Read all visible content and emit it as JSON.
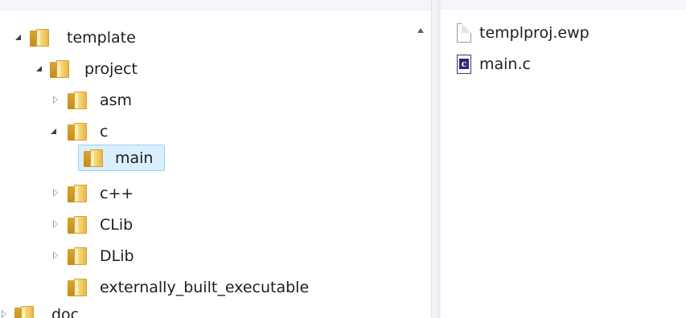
{
  "tree": {
    "items": [
      {
        "label": "template",
        "state": "expanded"
      },
      {
        "label": "project",
        "state": "expanded"
      },
      {
        "label": "asm",
        "state": "collapsed"
      },
      {
        "label": "c",
        "state": "expanded"
      },
      {
        "label": "main",
        "state": "selected"
      },
      {
        "label": "c++",
        "state": "collapsed"
      },
      {
        "label": "CLib",
        "state": "collapsed"
      },
      {
        "label": "DLib",
        "state": "collapsed"
      },
      {
        "label": "externally_built_executable",
        "state": "leaf"
      },
      {
        "label": "doc",
        "state": "collapsed"
      }
    ]
  },
  "files": {
    "items": [
      {
        "name": "templproj.ewp",
        "icon": "document-icon"
      },
      {
        "name": "main.c",
        "icon": "c-source-icon"
      }
    ]
  },
  "colors": {
    "selection_bg": "#daeffd",
    "selection_border": "#99d1f7",
    "folder": "#f4cf6a"
  }
}
